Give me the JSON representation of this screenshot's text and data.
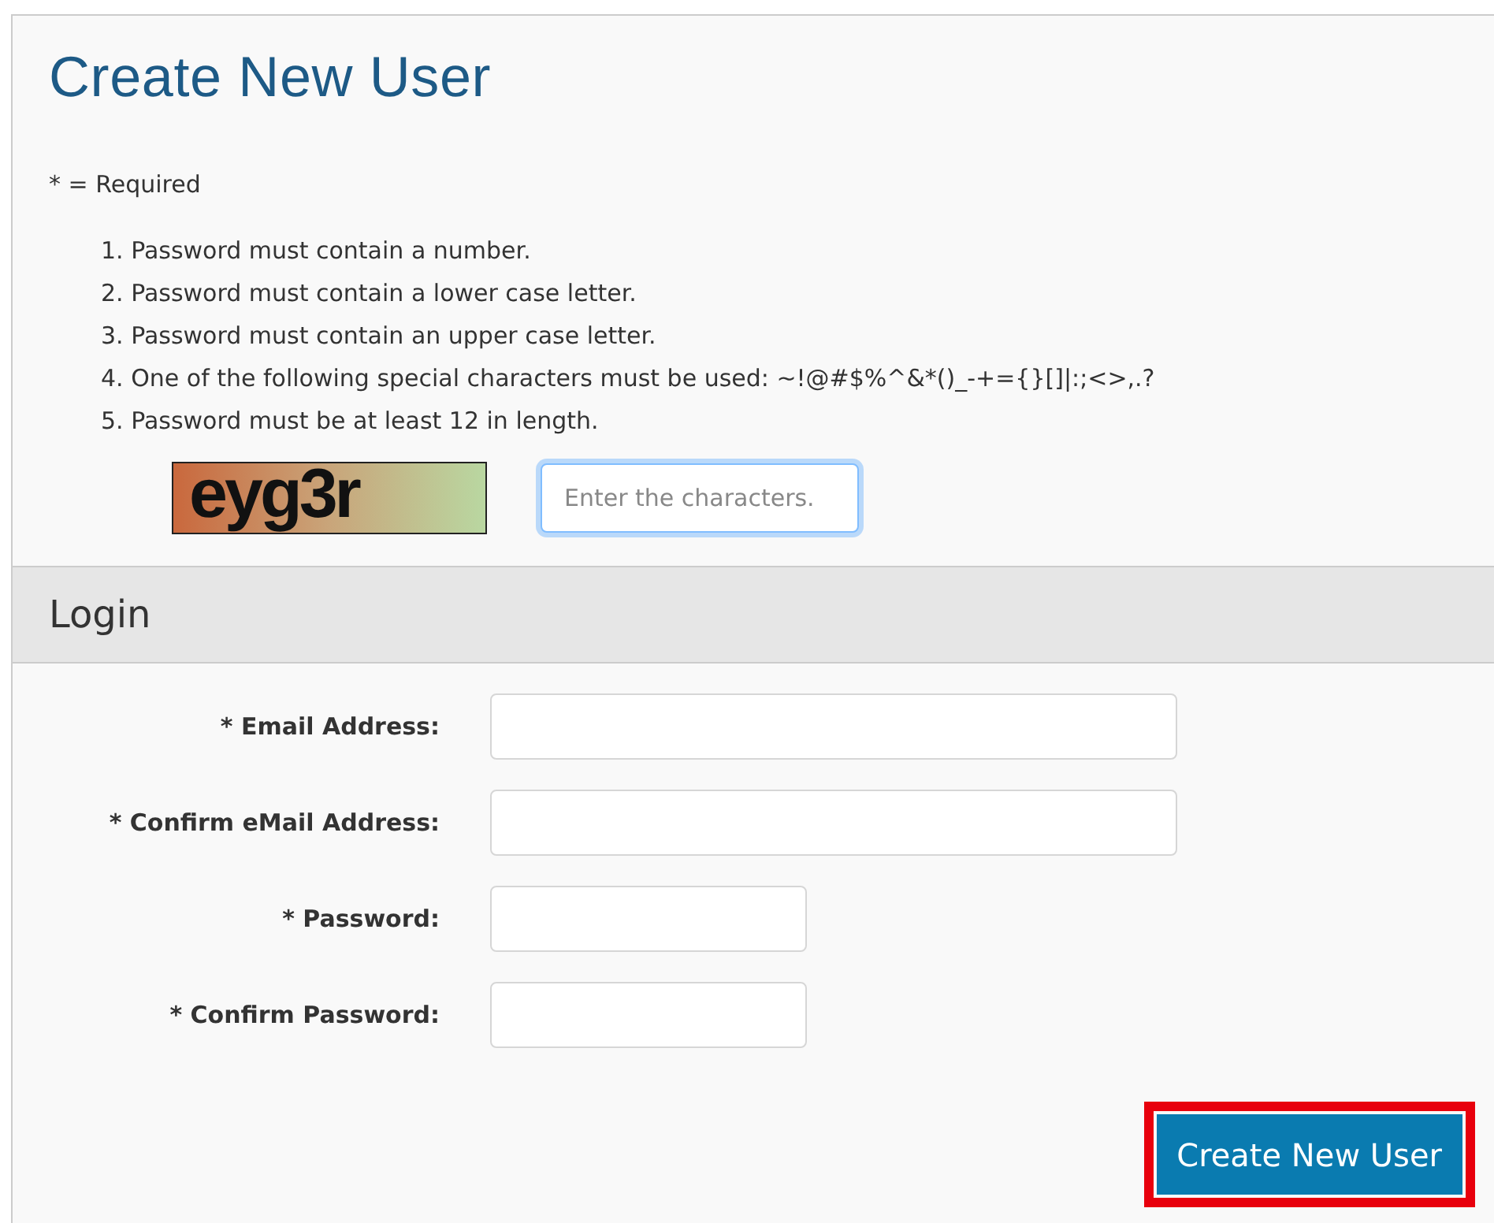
{
  "title": "Create New User",
  "required_note": "* = Required",
  "rules": [
    {
      "marker": "1.",
      "text": "Password must contain a number."
    },
    {
      "marker": "2.",
      "text": "Password must contain a lower case letter."
    },
    {
      "marker": "3.",
      "text": "Password must contain an upper case letter."
    },
    {
      "marker": "4.",
      "text": "One of the following special characters must be used: ~!@#$%^&*()_-+={}[]|:;<>,.?"
    },
    {
      "marker": "5.",
      "text": "Password must be at least 12 in length."
    }
  ],
  "captcha": {
    "text": "eyg3r",
    "placeholder": "Enter the characters.",
    "focused": true
  },
  "section": {
    "title": "Login"
  },
  "fields": [
    {
      "label": "* Email Address:",
      "kind": "wide"
    },
    {
      "label": "* Confirm eMail Address:",
      "kind": "wide"
    },
    {
      "label": "* Password:",
      "kind": "narrow"
    },
    {
      "label": "* Confirm Password:",
      "kind": "narrow"
    }
  ],
  "submit": {
    "label": "Create New User",
    "highlighted": true
  }
}
